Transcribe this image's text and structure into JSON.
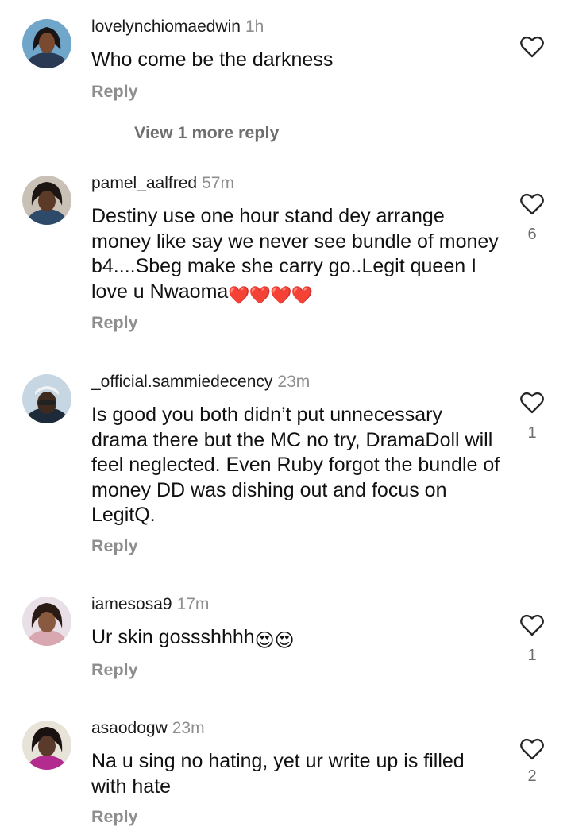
{
  "comments": [
    {
      "username": "lovelynchiomaedwin",
      "time": "1h",
      "text": "Who come be the darkness",
      "emojis": "",
      "reply_label": "Reply",
      "like_count": ""
    },
    {
      "username": "pamel_aalfred",
      "time": "57m",
      "text": "Destiny use one hour stand dey arrange money like say we never see bundle of money b4....Sbeg make she carry go..Legit queen I love u Nwaoma",
      "emojis": "❤️❤️❤️❤️",
      "reply_label": "Reply",
      "like_count": "6"
    },
    {
      "username": "_official.sammiedecency",
      "time": "23m",
      "text": "Is good you both didn’t put unnecessary drama there but the MC no try, DramaDoll will feel neglected. Even Ruby forgot the bundle of money DD was dishing out and focus on LegitQ.",
      "emojis": "",
      "reply_label": "Reply",
      "like_count": "1"
    },
    {
      "username": "iamesosa9",
      "time": "17m",
      "text": "Ur skin gossshhhh",
      "emojis": "😍😍",
      "reply_label": "Reply",
      "like_count": "1"
    },
    {
      "username": "asaodogw",
      "time": "23m",
      "text": "Na u sing no hating, yet ur write up is filled with hate",
      "emojis": "",
      "reply_label": "Reply",
      "like_count": "2"
    }
  ],
  "view_more_replies": "View 1 more reply",
  "icons": {
    "like": "heart-outline-icon",
    "emoji_heart": "red-heart-emoji",
    "emoji_eyes": "heart-eyes-emoji"
  },
  "colors": {
    "muted": "#8e8e8e",
    "text": "#111111",
    "heart_emoji": "#e8141f",
    "heart_eyes_face": "#f7c21c"
  }
}
